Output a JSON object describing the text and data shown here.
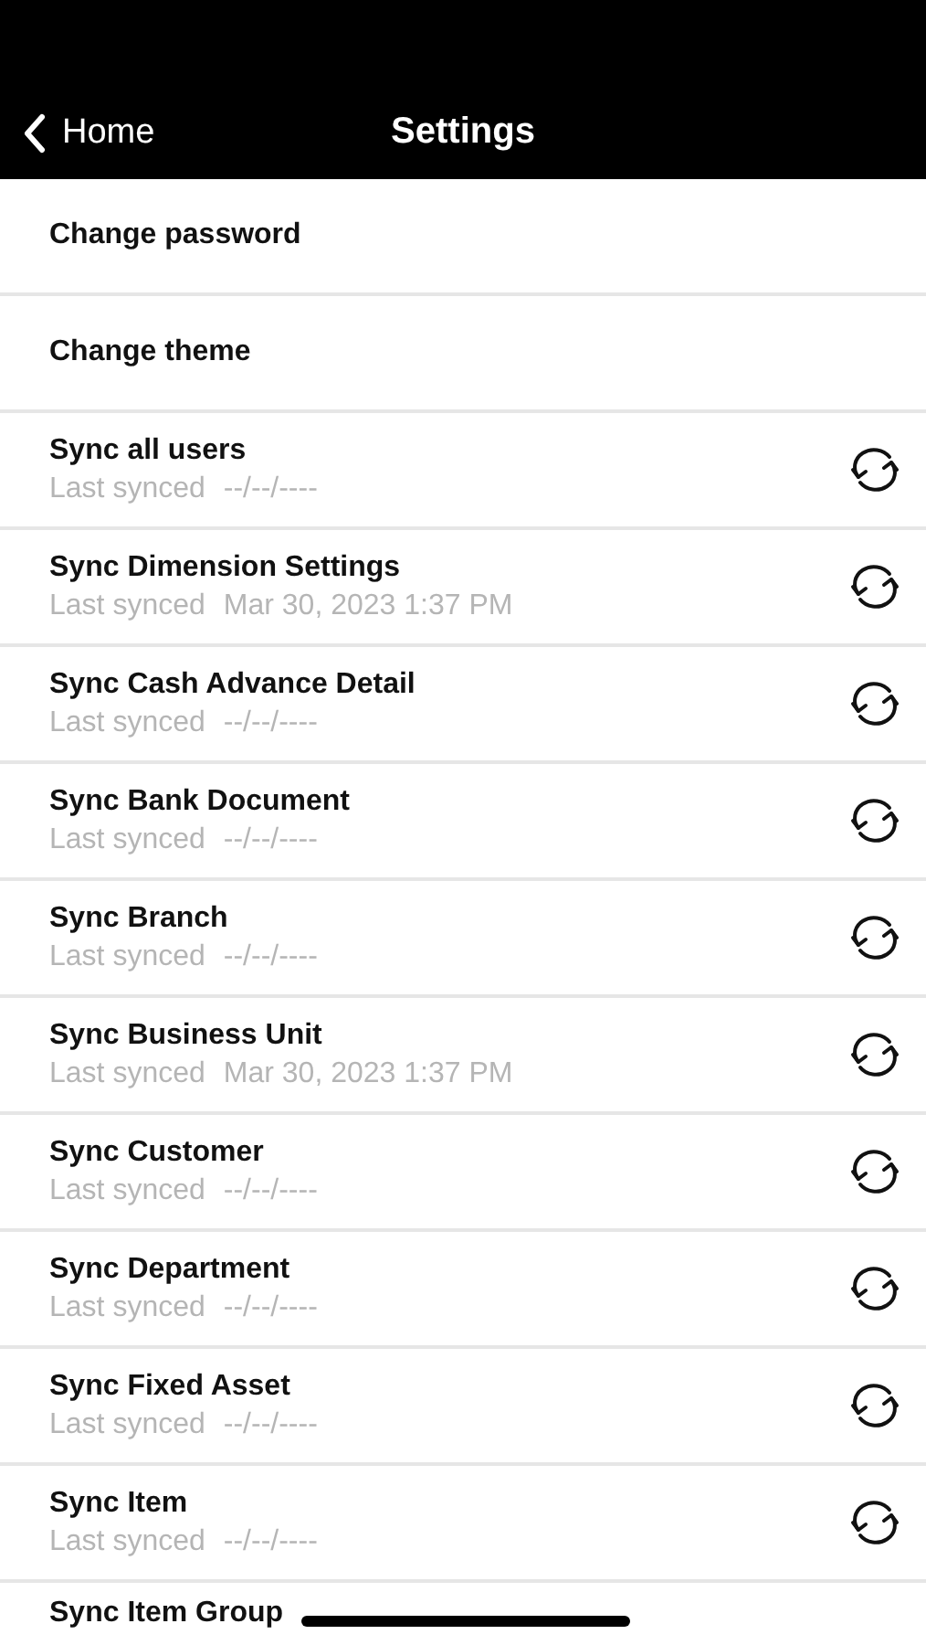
{
  "header": {
    "back_label": "Home",
    "title": "Settings"
  },
  "actions": [
    {
      "label": "Change password"
    },
    {
      "label": "Change theme"
    }
  ],
  "sync_items": [
    {
      "label": "Sync all users",
      "caption": "Last synced",
      "date": "--/--/----"
    },
    {
      "label": "Sync Dimension Settings",
      "caption": "Last synced",
      "date": "Mar 30, 2023 1:37 PM"
    },
    {
      "label": "Sync Cash Advance Detail",
      "caption": "Last synced",
      "date": "--/--/----"
    },
    {
      "label": "Sync Bank Document",
      "caption": "Last synced",
      "date": "--/--/----"
    },
    {
      "label": "Sync Branch",
      "caption": "Last synced",
      "date": "--/--/----"
    },
    {
      "label": "Sync Business Unit",
      "caption": "Last synced",
      "date": "Mar 30, 2023 1:37 PM"
    },
    {
      "label": "Sync Customer",
      "caption": "Last synced",
      "date": "--/--/----"
    },
    {
      "label": "Sync Department",
      "caption": "Last synced",
      "date": "--/--/----"
    },
    {
      "label": "Sync Fixed Asset",
      "caption": "Last synced",
      "date": "--/--/----"
    },
    {
      "label": "Sync Item",
      "caption": "Last synced",
      "date": "--/--/----"
    },
    {
      "label": "Sync Item Group"
    }
  ]
}
